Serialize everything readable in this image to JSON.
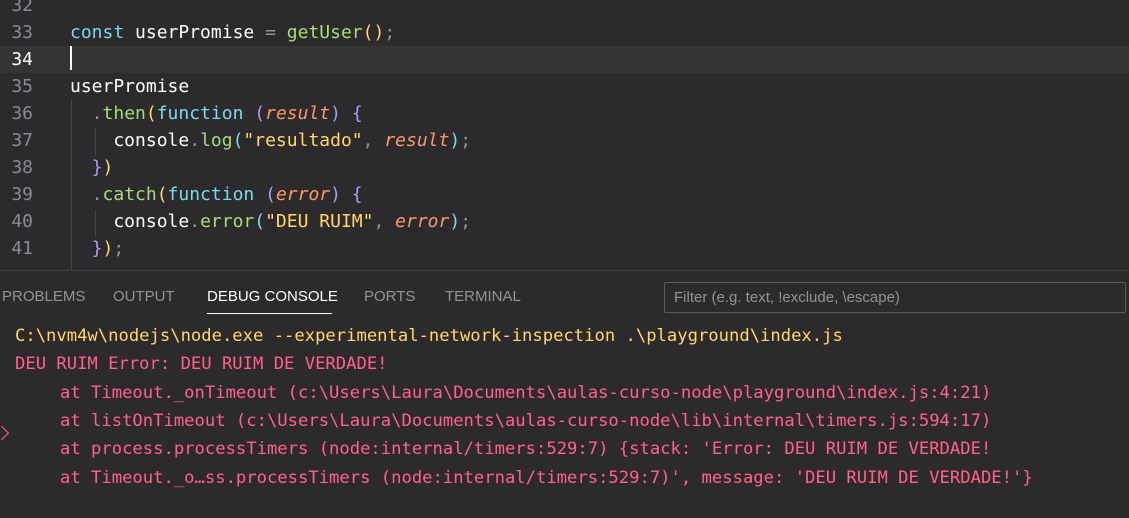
{
  "editor": {
    "lines": [
      {
        "num": "32",
        "tokens": []
      },
      {
        "num": "33",
        "tokens": [
          {
            "t": "const ",
            "c": "kw"
          },
          {
            "t": "userPromise",
            "c": "id"
          },
          {
            "t": " = ",
            "c": "pn"
          },
          {
            "t": "getUser",
            "c": "fn"
          },
          {
            "t": "()",
            "c": "p1"
          },
          {
            "t": ";",
            "c": "pn"
          }
        ]
      },
      {
        "num": "34",
        "tokens": [],
        "current": true
      },
      {
        "num": "35",
        "tokens": [
          {
            "t": "userPromise",
            "c": "id"
          }
        ]
      },
      {
        "num": "36",
        "tokens": [
          {
            "t": "  .",
            "c": "pn"
          },
          {
            "t": "then",
            "c": "fn"
          },
          {
            "t": "(",
            "c": "p1"
          },
          {
            "t": "function ",
            "c": "kw"
          },
          {
            "t": "(",
            "c": "p2"
          },
          {
            "t": "result",
            "c": "prm"
          },
          {
            "t": ") {",
            "c": "p2"
          }
        ]
      },
      {
        "num": "37",
        "tokens": [
          {
            "t": "    console",
            "c": "id"
          },
          {
            "t": ".",
            "c": "pn"
          },
          {
            "t": "log",
            "c": "fn"
          },
          {
            "t": "(",
            "c": "p3"
          },
          {
            "t": "\"resultado\"",
            "c": "str"
          },
          {
            "t": ", ",
            "c": "pn"
          },
          {
            "t": "result",
            "c": "prm"
          },
          {
            "t": ")",
            "c": "p3"
          },
          {
            "t": ";",
            "c": "pn"
          }
        ]
      },
      {
        "num": "38",
        "tokens": [
          {
            "t": "  }",
            "c": "p2"
          },
          {
            "t": ")",
            "c": "p1"
          }
        ]
      },
      {
        "num": "39",
        "tokens": [
          {
            "t": "  .",
            "c": "pn"
          },
          {
            "t": "catch",
            "c": "fn"
          },
          {
            "t": "(",
            "c": "p1"
          },
          {
            "t": "function ",
            "c": "kw"
          },
          {
            "t": "(",
            "c": "p2"
          },
          {
            "t": "error",
            "c": "prm"
          },
          {
            "t": ") {",
            "c": "p2"
          }
        ]
      },
      {
        "num": "40",
        "tokens": [
          {
            "t": "    console",
            "c": "id"
          },
          {
            "t": ".",
            "c": "pn"
          },
          {
            "t": "error",
            "c": "fn"
          },
          {
            "t": "(",
            "c": "p3"
          },
          {
            "t": "\"DEU RUIM\"",
            "c": "str"
          },
          {
            "t": ", ",
            "c": "pn"
          },
          {
            "t": "error",
            "c": "prm"
          },
          {
            "t": ")",
            "c": "p3"
          },
          {
            "t": ";",
            "c": "pn"
          }
        ]
      },
      {
        "num": "41",
        "tokens": [
          {
            "t": "  }",
            "c": "p2"
          },
          {
            "t": ")",
            "c": "p1"
          },
          {
            "t": ";",
            "c": "pn"
          }
        ]
      }
    ]
  },
  "panel": {
    "tabs": {
      "problems": "PROBLEMS",
      "output": "OUTPUT",
      "debug_console": "DEBUG CONSOLE",
      "ports": "PORTS",
      "terminal": "TERMINAL"
    },
    "active_tab": "DEBUG CONSOLE",
    "filter": {
      "placeholder": "Filter (e.g. text, !exclude, \\escape)",
      "value": ""
    },
    "console": {
      "command": "C:\\nvm4w\\nodejs\\node.exe --experimental-network-inspection .\\playground\\index.js",
      "error_line": "DEU RUIM Error: DEU RUIM DE VERDADE!",
      "stack": [
        "at Timeout._onTimeout (c:\\Users\\Laura\\Documents\\aulas-curso-node\\playground\\index.js:4:21)",
        "at listOnTimeout (c:\\Users\\Laura\\Documents\\aulas-curso-node\\lib\\internal\\timers.js:594:17)",
        "at process.processTimers (node:internal/timers:529:7) {stack: 'Error: DEU RUIM DE VERDADE!",
        "at Timeout._o…ss.processTimers (node:internal/timers:529:7)', message: 'DEU RUIM DE VERDADE!'}"
      ]
    }
  },
  "colors": {
    "background": "#2d2a2e",
    "current_line": "#363337",
    "console_command": "#ffd866",
    "console_error": "#ff6188"
  }
}
